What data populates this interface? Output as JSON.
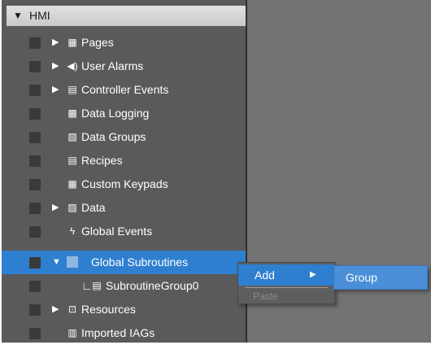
{
  "tree": {
    "root": {
      "label": "HMI",
      "icon": "triangle-down-icon"
    },
    "items": [
      {
        "label": "Pages",
        "icon": "pages-icon",
        "expand": "▶"
      },
      {
        "label": "User Alarms",
        "icon": "speaker-icon",
        "expand": "▶"
      },
      {
        "label": "Controller Events",
        "icon": "calendar-icon",
        "expand": "▶"
      },
      {
        "label": "Data Logging",
        "icon": "data-logging-icon"
      },
      {
        "label": "Data Groups",
        "icon": "data-groups-icon"
      },
      {
        "label": "Recipes",
        "icon": "recipes-icon"
      },
      {
        "label": "Custom Keypads",
        "icon": "keypad-icon"
      },
      {
        "label": "Data",
        "icon": "data-icon",
        "expand": "▶"
      },
      {
        "label": "Global Events",
        "icon": "lightning-icon"
      },
      {
        "label": "Global Subroutines",
        "icon": "subroutines-icon",
        "expand": "▼",
        "selected": true
      },
      {
        "label": "SubroutineGroup0",
        "icon": "subroutine-group-icon",
        "prefix": "∟"
      },
      {
        "label": "Resources",
        "icon": "resources-icon",
        "expand": "▶"
      },
      {
        "label": "Imported IAGs",
        "icon": "iag-icon"
      }
    ]
  },
  "context_menu": {
    "add_label": "Add",
    "add_arrow": "▶",
    "paste_label": "Paste"
  },
  "submenu": {
    "group_label": "Group"
  },
  "colors": {
    "tree_bg": "#5a5a5a",
    "right_pane_bg": "#737373",
    "selection": "#2f7fd0"
  }
}
